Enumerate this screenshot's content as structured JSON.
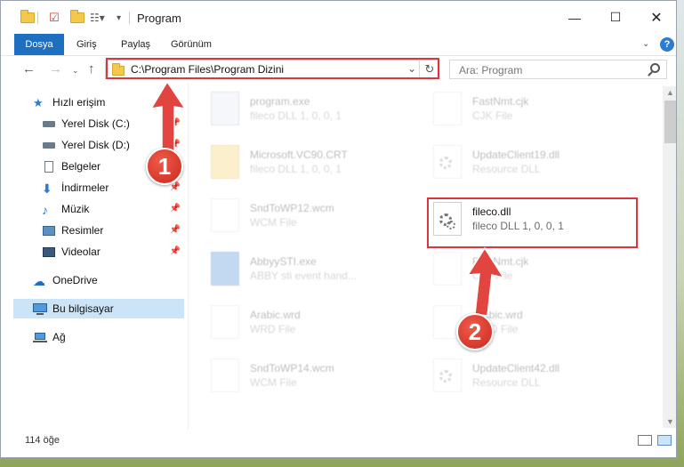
{
  "window": {
    "title": "Program"
  },
  "ribbon": {
    "tabs": [
      "Dosya",
      "Giriş",
      "Paylaş",
      "Görünüm"
    ]
  },
  "address": {
    "path": "C:\\Program Files\\Program Dizini"
  },
  "search": {
    "placeholder": "Ara: Program"
  },
  "sidebar": {
    "items": [
      {
        "label": "Hızlı erişim",
        "icon": "star-icon"
      },
      {
        "label": "Yerel Disk (C:)",
        "icon": "drive-icon"
      },
      {
        "label": "Yerel Disk (D:)",
        "icon": "drive-icon"
      },
      {
        "label": "Belgeler",
        "icon": "documents-icon"
      },
      {
        "label": "İndirmeler",
        "icon": "download-icon"
      },
      {
        "label": "Müzik",
        "icon": "music-icon"
      },
      {
        "label": "Resimler",
        "icon": "pictures-icon"
      },
      {
        "label": "Videolar",
        "icon": "videos-icon"
      },
      {
        "label": "OneDrive",
        "icon": "cloud-icon"
      },
      {
        "label": "Bu bilgisayar",
        "icon": "computer-icon"
      },
      {
        "label": "Ağ",
        "icon": "network-icon"
      }
    ]
  },
  "files": [
    {
      "name": "program.exe",
      "desc": "fileco DLL 1, 0, 0, 1"
    },
    {
      "name": "FastNmt.cjk",
      "desc": "CJK File"
    },
    {
      "name": "Microsoft.VC90.CRT",
      "desc": "fileco DLL 1, 0, 0, 1"
    },
    {
      "name": "UpdateClient19.dll",
      "desc": "Resource DLL"
    },
    {
      "name": "SndToWP12.wcm",
      "desc": "WCM File"
    },
    {
      "name": "fileco.dll",
      "desc": "fileco DLL 1, 0, 0, 1"
    },
    {
      "name": "AbbyySTI.exe",
      "desc": "ABBY sti event hand..."
    },
    {
      "name": "FastNmt.cjk",
      "desc": "CJK File"
    },
    {
      "name": "Arabic.wrd",
      "desc": "WRD File"
    },
    {
      "name": "Arabic.wrd",
      "desc": "WRD File"
    },
    {
      "name": "SndToWP14.wcm",
      "desc": "WCM File"
    },
    {
      "name": "UpdateClient42.dll",
      "desc": "Resource DLL"
    }
  ],
  "status": {
    "count": "114 öğe"
  },
  "annotations": {
    "step1": "1",
    "step2": "2"
  },
  "colors": {
    "accent": "#1f6fc0",
    "highlight": "#d9373b",
    "selected": "#cce4f7"
  }
}
